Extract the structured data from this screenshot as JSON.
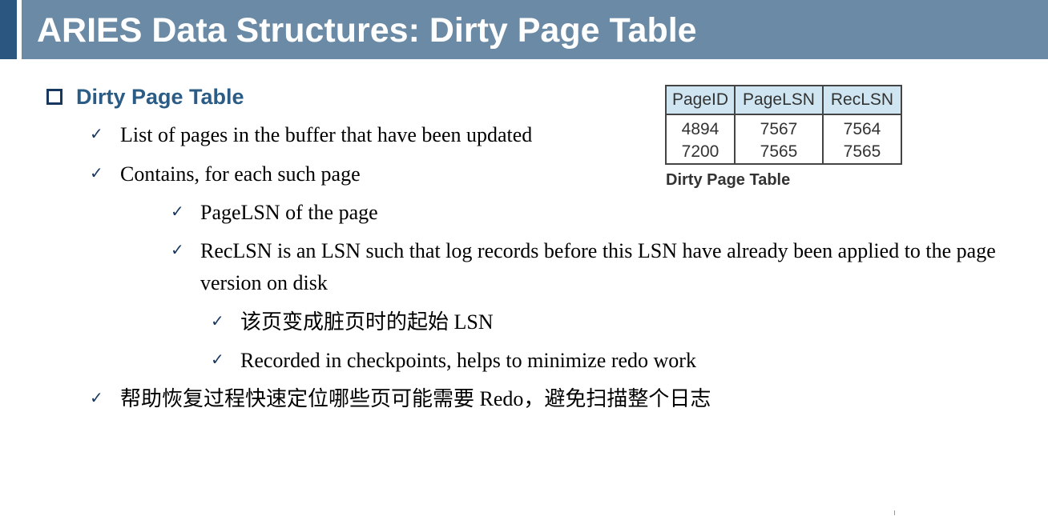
{
  "slide": {
    "title": "ARIES Data Structures: Dirty Page Table",
    "heading": "Dirty Page Table",
    "bullets": [
      "List of pages in the buffer that have been updated",
      "Contains, for each such page",
      "PageLSN of the page",
      "RecLSN is an LSN such that log records before this LSN have already been applied to the page version on disk",
      "该页变成脏页时的起始 LSN",
      "Recorded in checkpoints, helps to minimize redo work",
      "帮助恢复过程快速定位哪些页可能需要 Redo，避免扫描整个日志"
    ],
    "check_glyph": "✓"
  },
  "table": {
    "headers": [
      "PageID",
      "PageLSN",
      "RecLSN"
    ],
    "rows": [
      [
        "4894",
        "7567",
        "7564"
      ],
      [
        "7200",
        "7565",
        "7565"
      ]
    ],
    "caption": "Dirty Page Table",
    "header_bg": "#cfe6f2"
  },
  "colors": {
    "title_bar": "#6b8aa5",
    "accent": "#2a5680",
    "heading": "#2b5c86",
    "check": "#17375e"
  }
}
